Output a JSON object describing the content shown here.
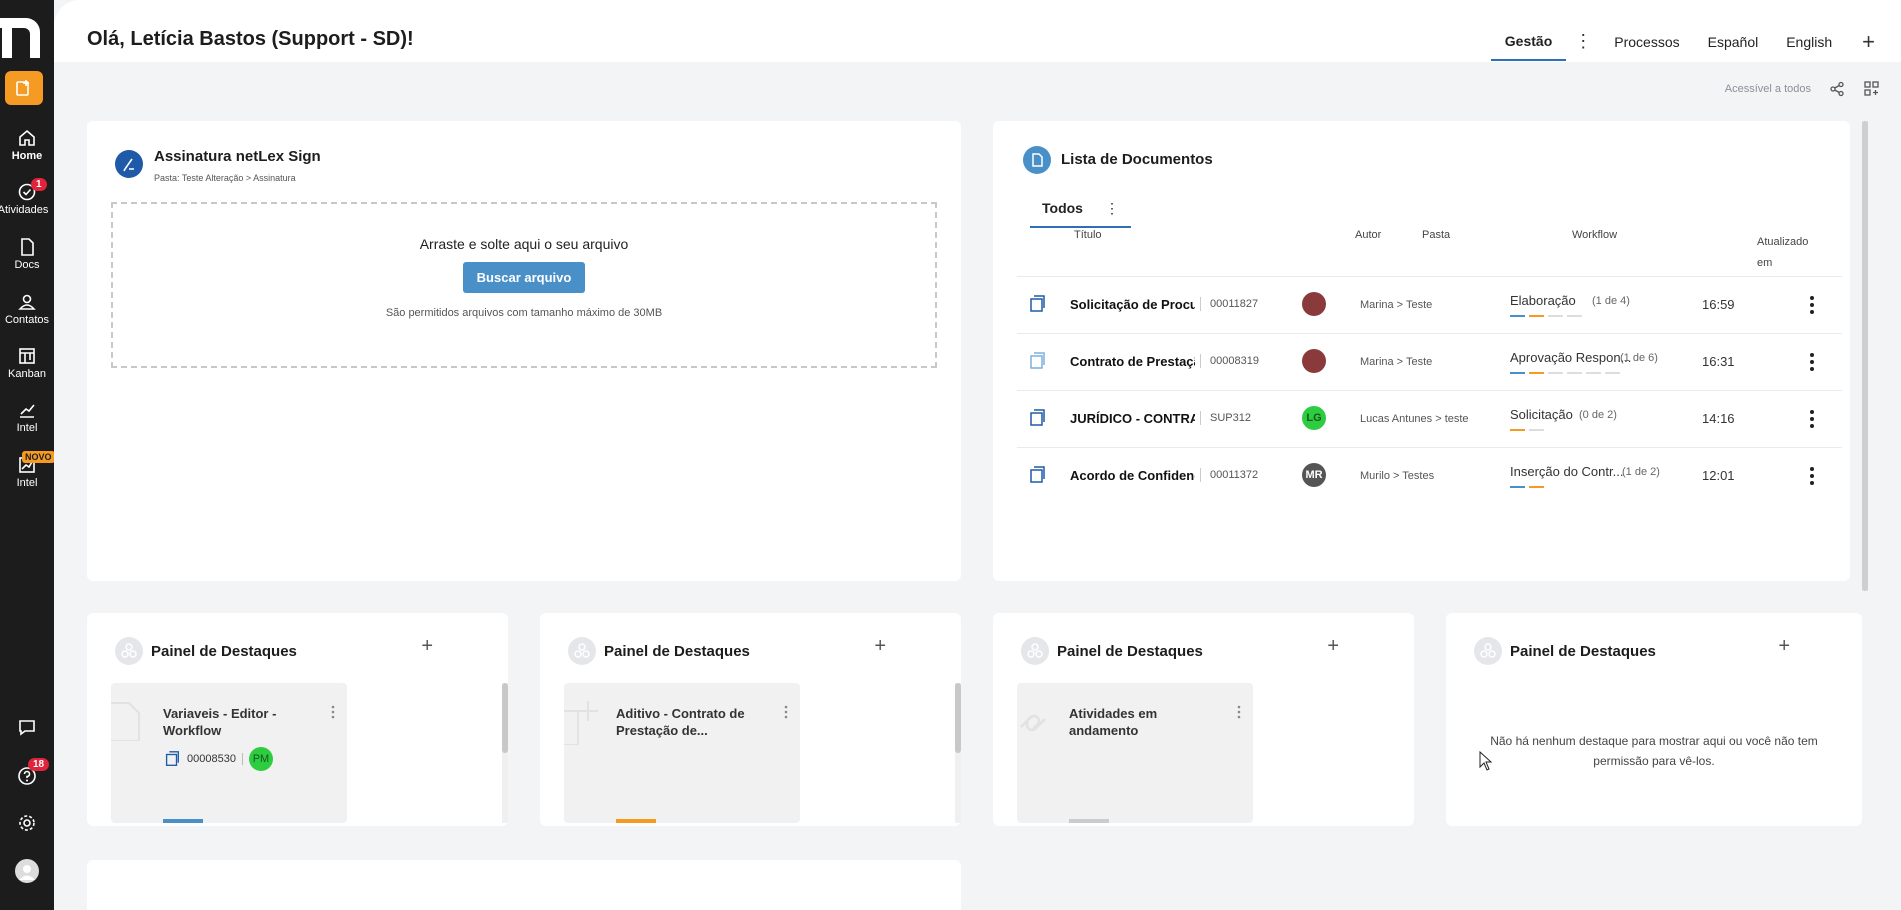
{
  "sidebar": {
    "brand_color": "#1c1c1c",
    "new_button_color": "#f59a23",
    "items": [
      {
        "label": "Home",
        "icon": "home-icon"
      },
      {
        "label": "Atividades",
        "icon": "check-circle-icon",
        "badge": "1"
      },
      {
        "label": "Docs",
        "icon": "document-icon"
      },
      {
        "label": "Contatos",
        "icon": "user-icon"
      },
      {
        "label": "Kanban",
        "icon": "kanban-icon"
      },
      {
        "label": "Intel",
        "icon": "chart-icon"
      },
      {
        "label": "Intel",
        "icon": "chart-new-icon",
        "tag": "NOVO"
      }
    ],
    "help_badge": "18"
  },
  "header": {
    "greeting": "Olá, Letícia Bastos (Support - SD)!",
    "tabs": [
      "Gestão",
      "Processos",
      "Español",
      "English"
    ],
    "accessible": "Acessível a todos"
  },
  "sign": {
    "title": "Assinatura netLex Sign",
    "path": "Pasta: Teste Alteração > Assinatura",
    "drop_text": "Arraste e solte aqui o seu arquivo",
    "button": "Buscar arquivo",
    "note": "São permitidos arquivos com tamanho máximo de 30MB"
  },
  "docs": {
    "title": "Lista de Documentos",
    "tab": "Todos",
    "headers": {
      "titulo": "Título",
      "autor": "Autor",
      "pasta": "Pasta",
      "workflow": "Workflow",
      "atualizado": "Atualizado em"
    },
    "rows": [
      {
        "title": "Solicitação de Procuração",
        "code": "00011827",
        "avatar_text": "",
        "avatar_color": "#8a3a3a",
        "pasta": "Marina  >  Teste",
        "workflow": "Elaboração",
        "count": "(1 de 4)",
        "time": "16:59"
      },
      {
        "title": "Contrato de Prestação",
        "code": "00008319",
        "avatar_text": "",
        "avatar_color": "#8a3a3a",
        "pasta": "Marina  >  Teste",
        "workflow": "Aprovação Respon...",
        "count": "(1 de 6)",
        "time": "16:31"
      },
      {
        "title": "JURÍDICO - CONTRATO",
        "code": "SUP312",
        "avatar_text": "LG",
        "avatar_color": "#2ecc40",
        "pasta": "Lucas Antunes  >  teste",
        "workflow": "Solicitação",
        "count": "(0 de 2)",
        "time": "14:16"
      },
      {
        "title": "Acordo de Confidencialidade",
        "code": "00011372",
        "avatar_text": "MR",
        "avatar_color": "#555555",
        "pasta": "Murilo  >  Testes",
        "workflow": "Inserção do Contr...",
        "count": "(1 de 2)",
        "time": "12:01"
      }
    ]
  },
  "panels": [
    {
      "title": "Painel de Destaques",
      "card_title": "Variaveis - Editor - Workflow",
      "code": "00008530",
      "avatar": "PM",
      "stripe": "#4a90c8"
    },
    {
      "title": "Painel de Destaques",
      "card_title": "Aditivo - Contrato de Prestação de...",
      "stripe": "#f59a23"
    },
    {
      "title": "Painel de Destaques",
      "card_title": "Atividades em andamento",
      "stripe": "#cccccc"
    },
    {
      "title": "Painel de Destaques",
      "empty": "Não há nenhum destaque para mostrar aqui ou você não tem permissão para vê-los."
    }
  ]
}
